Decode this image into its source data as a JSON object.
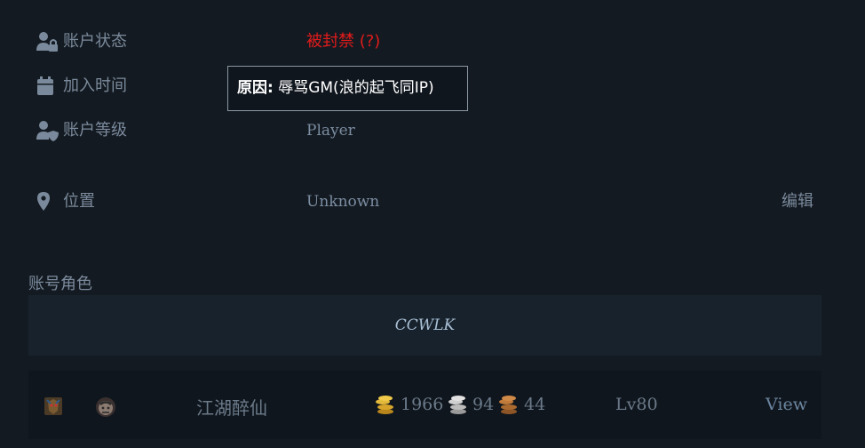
{
  "account": {
    "status_label": "账户状态",
    "status_value": "被封禁 (?)",
    "joined_label": "加入时间",
    "level_label": "账户等级",
    "level_value": "Player",
    "location_label": "位置",
    "location_value": "Unknown",
    "edit_label": "编辑"
  },
  "tooltip": {
    "reason_label": "原因:",
    "reason_text": "辱骂GM(浪的起飞同IP)"
  },
  "characters": {
    "section_title": "账号角色",
    "realm": "CCWLK",
    "rows": [
      {
        "name": "江湖醉仙",
        "gold": "1966",
        "silver": "94",
        "copper": "44",
        "level": "Lv80",
        "view_label": "View"
      }
    ]
  },
  "colors": {
    "background": "#141a21",
    "banned": "#e01b1b",
    "gold": "#d6a52a",
    "silver": "#c9c9c9",
    "copper": "#c07a3a"
  },
  "icons": {
    "status": "user-lock-icon",
    "joined": "calendar-icon",
    "level": "user-shield-icon",
    "location": "map-marker-icon"
  }
}
